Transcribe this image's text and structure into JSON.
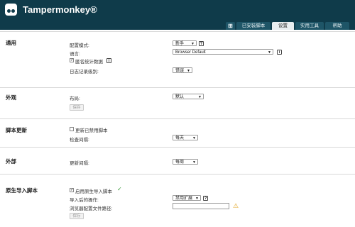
{
  "app": {
    "title": "Tampermonkey®"
  },
  "tabs": [
    {
      "label": "⊞"
    },
    {
      "label": "已安装脚本"
    },
    {
      "label": "设置"
    },
    {
      "label": "实用工具"
    },
    {
      "label": "帮助"
    }
  ],
  "general": {
    "title": "通用",
    "config_mode_label": "配置模式:",
    "config_mode_value": "新手",
    "language_label": "语言:",
    "language_value": "Browser Default",
    "anonymous_stats_label": "匿名统计数据",
    "log_level_label": "日志记录级别:",
    "log_level_value": "错误",
    "help_glyph": "?",
    "info_glyph": "i"
  },
  "appearance": {
    "title": "外观",
    "layout_label": "布局:",
    "layout_value": "默认",
    "save_label": "保存"
  },
  "script_update": {
    "title": "脚本更新",
    "update_disabled_label": "更新已禁用脚本",
    "check_interval_label": "检查间隔:",
    "check_interval_value": "每天"
  },
  "external": {
    "title": "外部",
    "update_interval_label": "更新间隔:",
    "update_interval_value": "每周"
  },
  "native_import": {
    "title": "原生导入脚本",
    "enable_label": "启用原生导入脚本",
    "after_import_label": "导入后的操作:",
    "after_import_value": "禁用扩展",
    "browser_profile_label": "浏览器配置文件路径:",
    "browser_profile_value": "",
    "save_label": "保存"
  },
  "colors": {
    "header_bg": "#0f3b4a",
    "tab_bg": "#1e5567",
    "tab_active_bg": "#e9eef0",
    "check_green": "#3a9a3a",
    "warning": "#e0a21a"
  },
  "icons": {
    "logo": "tampermonkey-logo-icon",
    "check": "check-icon",
    "warning": "warning-icon"
  }
}
